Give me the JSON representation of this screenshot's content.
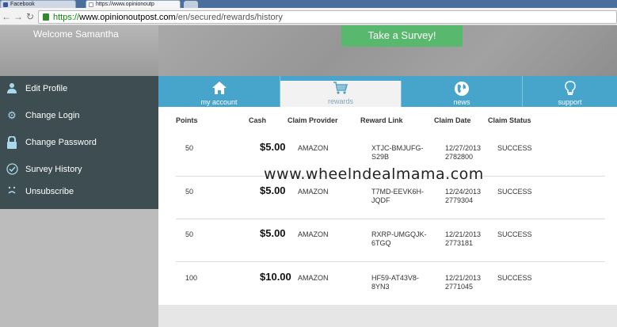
{
  "browser": {
    "tabs": [
      {
        "label": "Facebook"
      },
      {
        "label": "https://www.opinionoutp"
      }
    ],
    "url": {
      "scheme": "https://",
      "host": "www.opinionoutpost.com",
      "path": "/en/secured/rewards/history"
    }
  },
  "header": {
    "welcome": "Welcome Samantha",
    "survey_button": "Take a Survey!"
  },
  "sidebar": {
    "items": [
      {
        "label": "Edit Profile",
        "icon": "user-icon"
      },
      {
        "label": "Change Login",
        "icon": "gear-icon"
      },
      {
        "label": "Change Password",
        "icon": "lock-icon"
      },
      {
        "label": "Survey History",
        "icon": "check-circle-icon"
      },
      {
        "label": "Unsubscribe",
        "icon": "sad-face-icon"
      }
    ]
  },
  "nav": {
    "tabs": [
      {
        "label": "my account",
        "icon": "home-icon"
      },
      {
        "label": "rewards",
        "icon": "cart-icon"
      },
      {
        "label": "news",
        "icon": "globe-icon"
      },
      {
        "label": "support",
        "icon": "lightbulb-icon"
      }
    ],
    "active": "rewards"
  },
  "table": {
    "headers": [
      "Points",
      "Cash",
      "Claim Provider",
      "Reward Link",
      "Claim Date",
      "Claim Status"
    ],
    "rows": [
      {
        "points": "50",
        "cash": "$5.00",
        "provider": "AMAZON",
        "link1": "XTJC-BMJUFG-",
        "link2": "S29B",
        "date": "12/27/2013",
        "id": "2782800",
        "status": "SUCCESS"
      },
      {
        "points": "50",
        "cash": "$5.00",
        "provider": "AMAZON",
        "link1": "T7MD-EEVK6H-",
        "link2": "JQDF",
        "date": "12/24/2013",
        "id": "2779304",
        "status": "SUCCESS"
      },
      {
        "points": "50",
        "cash": "$5.00",
        "provider": "AMAZON",
        "link1": "RXRP-UMGQJK-",
        "link2": "6TGQ",
        "date": "12/21/2013",
        "id": "2773181",
        "status": "SUCCESS"
      },
      {
        "points": "100",
        "cash": "$10.00",
        "provider": "AMAZON",
        "link1": "HF59-AT43V8-",
        "link2": "8YN3",
        "date": "12/21/2013",
        "id": "2771045",
        "status": "SUCCESS"
      }
    ]
  },
  "watermark": "www.wheelndealmama.com"
}
